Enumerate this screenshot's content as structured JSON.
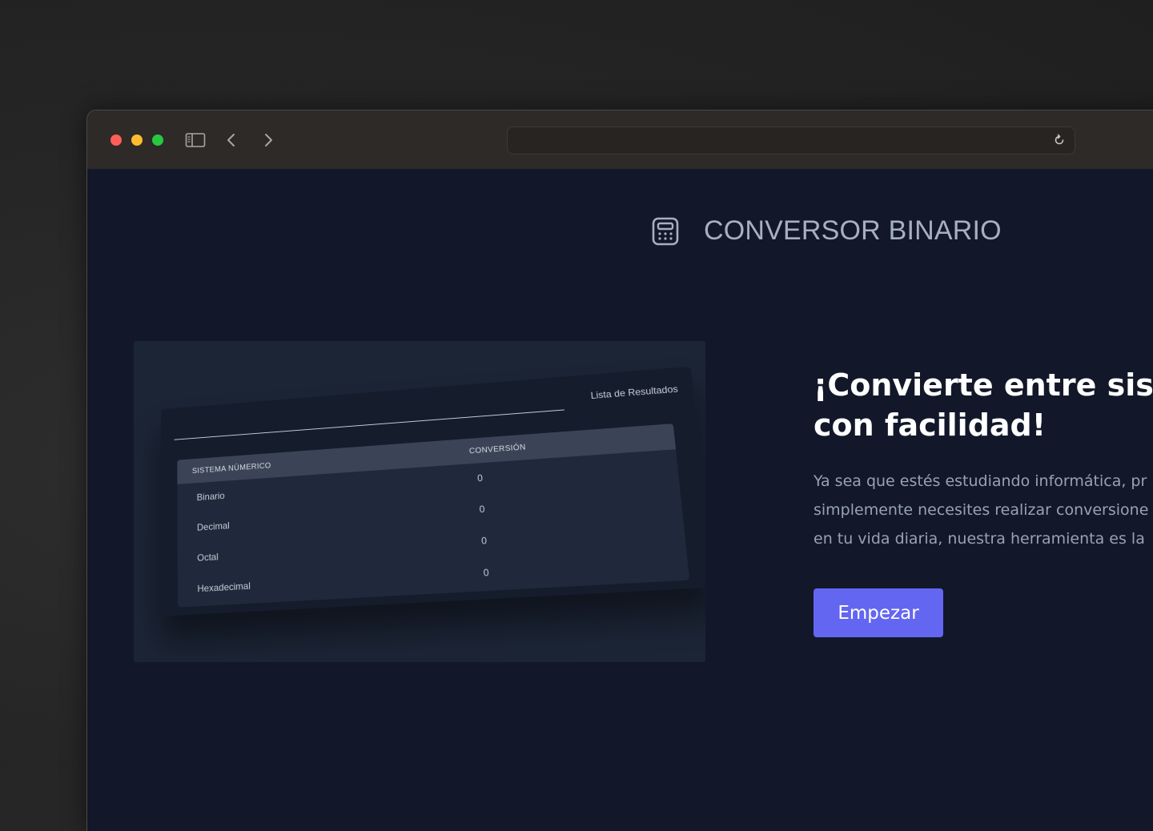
{
  "browser": {
    "url": ""
  },
  "header": {
    "logo_icon": "calculator-icon",
    "title": "CONVERSOR BINARIO"
  },
  "preview": {
    "results_title": "Lista de Resultados",
    "columns": [
      "SISTEMA NÚMERICO",
      "CONVERSIÓN"
    ],
    "rows": [
      {
        "name": "Binario",
        "value": "0"
      },
      {
        "name": "Decimal",
        "value": "0"
      },
      {
        "name": "Octal",
        "value": "0"
      },
      {
        "name": "Hexadecimal",
        "value": "0"
      }
    ]
  },
  "hero": {
    "title_line1": "¡Convierte entre sistem",
    "title_line2": "con facilidad!",
    "desc_line1": "Ya sea que estés estudiando informática, pr",
    "desc_line2": "simplemente necesites realizar conversione",
    "desc_line3": "en tu vida diaria, nuestra herramienta es la",
    "cta_label": "Empezar"
  },
  "colors": {
    "accent": "#6366f1",
    "page_bg": "#121829",
    "titlebar_bg": "#2d2a28"
  }
}
